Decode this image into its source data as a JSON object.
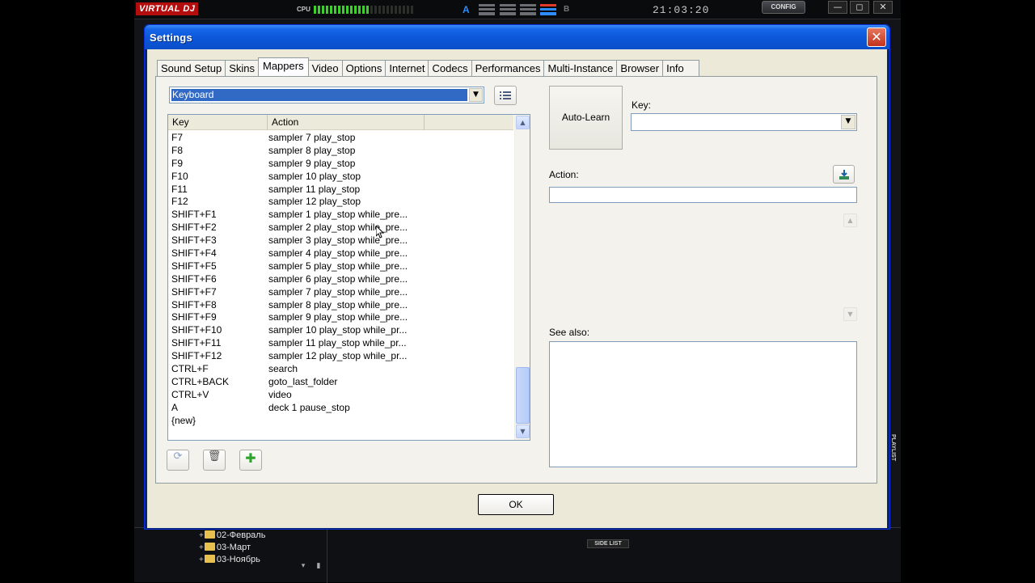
{
  "background_app": {
    "logo": "VIRTUAL DJ",
    "cpu_label": "CPU",
    "cpu_load_fraction": 0.55,
    "deck_a_label": "A",
    "deck_b_label": "B",
    "clock": "21:03:20",
    "config_button": "CONFIG",
    "window_controls": {
      "minimize": "—",
      "maximize": "◻",
      "close": "✕"
    },
    "playlist_label": "PLAYLIST",
    "side_list_label": "SIDE LIST",
    "browser_folders": [
      "02-Февраль",
      "03-Март",
      "03-Ноябрь"
    ],
    "folder_expand_symbol": "+"
  },
  "dialog": {
    "title": "Settings",
    "close_symbol": "✕",
    "tabs": [
      "Sound Setup",
      "Skins",
      "Mappers",
      "Video",
      "Options",
      "Internet",
      "Codecs",
      "Performances",
      "Multi-Instance",
      "Browser",
      "Info"
    ],
    "active_tab": "Mappers",
    "mapper_select": {
      "value": "Keyboard",
      "arrow": "▼"
    },
    "list": {
      "columns": [
        "Key",
        "Action"
      ],
      "rows": [
        {
          "key": "F7",
          "action": "sampler 7 play_stop"
        },
        {
          "key": "F8",
          "action": "sampler 8 play_stop"
        },
        {
          "key": "F9",
          "action": "sampler 9 play_stop"
        },
        {
          "key": "F10",
          "action": "sampler 10 play_stop"
        },
        {
          "key": "F11",
          "action": "sampler 11 play_stop"
        },
        {
          "key": "F12",
          "action": "sampler 12 play_stop"
        },
        {
          "key": "SHIFT+F1",
          "action": "sampler 1 play_stop while_pre..."
        },
        {
          "key": "SHIFT+F2",
          "action": "sampler 2 play_stop while_pre..."
        },
        {
          "key": "SHIFT+F3",
          "action": "sampler 3 play_stop while_pre..."
        },
        {
          "key": "SHIFT+F4",
          "action": "sampler 4 play_stop while_pre..."
        },
        {
          "key": "SHIFT+F5",
          "action": "sampler 5 play_stop while_pre..."
        },
        {
          "key": "SHIFT+F6",
          "action": "sampler 6 play_stop while_pre..."
        },
        {
          "key": "SHIFT+F7",
          "action": "sampler 7 play_stop while_pre..."
        },
        {
          "key": "SHIFT+F8",
          "action": "sampler 8 play_stop while_pre..."
        },
        {
          "key": "SHIFT+F9",
          "action": "sampler 9 play_stop while_pre..."
        },
        {
          "key": "SHIFT+F10",
          "action": "sampler 10 play_stop while_pr..."
        },
        {
          "key": "SHIFT+F11",
          "action": "sampler 11 play_stop while_pr..."
        },
        {
          "key": "SHIFT+F12",
          "action": "sampler 12 play_stop while_pr..."
        },
        {
          "key": "CTRL+F",
          "action": "search"
        },
        {
          "key": "CTRL+BACK",
          "action": "goto_last_folder"
        },
        {
          "key": "CTRL+V",
          "action": "video"
        },
        {
          "key": "A",
          "action": "deck 1 pause_stop"
        },
        {
          "key": "{new}",
          "action": ""
        }
      ]
    },
    "list_buttons": {
      "delete_icon": "🗑",
      "add_icon": "✚",
      "options_icon": "⟳"
    },
    "auto_learn_label": "Auto-Learn",
    "key_label": "Key:",
    "key_value": "",
    "action_label": "Action:",
    "action_value": "",
    "see_also_label": "See also:",
    "ok_label": "OK"
  }
}
